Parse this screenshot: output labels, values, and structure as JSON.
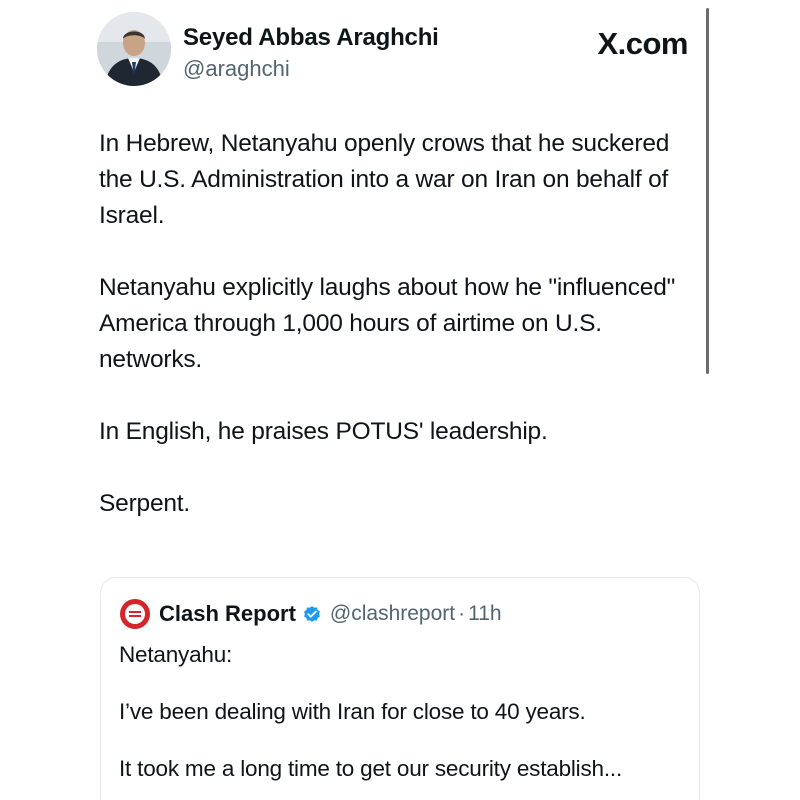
{
  "author": {
    "name": "Seyed Abbas Araghchi",
    "handle": "@araghchi",
    "avatar_icon": "profile-photo"
  },
  "site_label": "X.com",
  "tweet": {
    "paragraphs": [
      "In Hebrew, Netanyahu openly crows that he suckered the U.S. Administration into a war on Iran on behalf of Israel.",
      "Netanyahu explicitly laughs about how he \"influenced\" America through 1,000 hours of airtime on U.S. networks.",
      "In English, he praises POTUS' leadership.",
      "Serpent."
    ]
  },
  "quote": {
    "name": "Clash Report",
    "verified": true,
    "handle": "@clashreport",
    "separator": "·",
    "time": "11h",
    "logo_icon": "clash-report-logo",
    "logo_color": "#d6252a",
    "paragraphs": [
      "Netanyahu:",
      "I’ve been dealing with Iran for close to 40 years.",
      "It took me a long time to get our security establish..."
    ]
  },
  "colors": {
    "text": "#0f1419",
    "secondary": "#536471",
    "verified": "#1d9bf0",
    "border": "#e6e9ec"
  }
}
